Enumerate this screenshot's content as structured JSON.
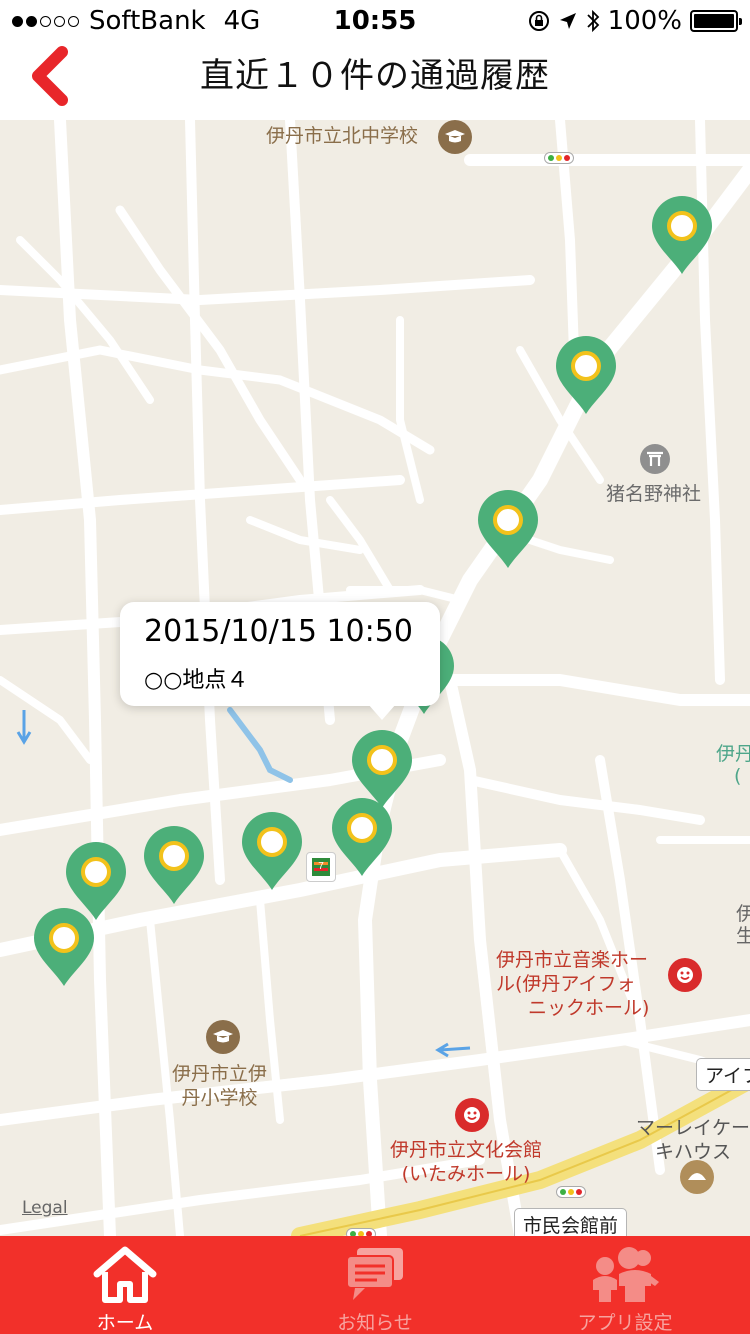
{
  "status_bar": {
    "carrier": "SoftBank",
    "network": "4G",
    "time": "10:55",
    "battery": "100%",
    "signal_bars_filled": 2,
    "signal_bars_total": 5,
    "icons": [
      "orientation-lock-icon",
      "location-arrow-icon",
      "bluetooth-icon",
      "battery-icon"
    ]
  },
  "nav": {
    "title": "直近１０件の通過履歴",
    "back_icon": "chevron-left-icon",
    "accent_color": "#e8262a"
  },
  "map": {
    "poi_labels": {
      "school_north": "伊丹市立北中学校",
      "shrine": "猪名野神社",
      "music_hall_line1": "伊丹市立音楽ホー",
      "music_hall_line2": "ル(伊丹アイフォ",
      "music_hall_line3": "ニックホール)",
      "itami_school_line1": "伊丹市立伊",
      "itami_school_line2": "丹小学校",
      "culture_hall_line1": "伊丹市立文化会館",
      "culture_hall_line2": "(いたみホール)",
      "cake_shop_line1": "マーレイケー",
      "cake_shop_line2": "キハウス",
      "edge_label_1": "伊丹",
      "edge_label_2": "(",
      "edge_label_3": "伊",
      "edge_label_4": "生"
    },
    "road_signs": {
      "shimin_kaikan": "市民会館前",
      "aifo": "アイフ"
    },
    "legal": "Legal",
    "marker_color": "#4caf79",
    "marker_ring_color": "#f2c21b",
    "marker_count": 10
  },
  "callout": {
    "title": "2015/10/15 10:50",
    "subtitle": "○○地点４"
  },
  "tabs": [
    {
      "label": "ホーム",
      "icon": "home-icon",
      "active": true
    },
    {
      "label": "お知らせ",
      "icon": "message-icon",
      "active": false
    },
    {
      "label": "アプリ設定",
      "icon": "family-icon",
      "active": false
    }
  ],
  "tab_bar_color": "#f2302a"
}
